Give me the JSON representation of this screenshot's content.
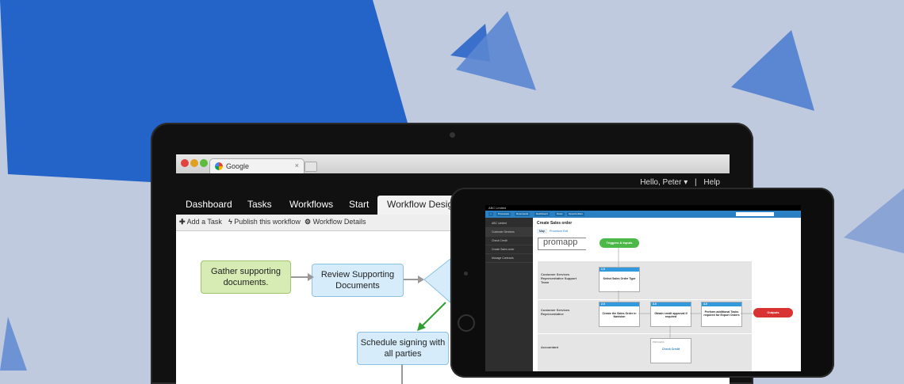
{
  "colors": {
    "background": "#c0cade",
    "triangle_primary": "#2463c8",
    "triangle_light": "#5a86d2",
    "app_header": "#111111",
    "tablet_nav": "#2b80c4",
    "node_green": "#d7ecb4",
    "node_blue": "#d6ecfa",
    "trigger_green": "#4cb848",
    "outputs_red": "#d93232"
  },
  "laptop": {
    "browser": {
      "tab_title": "Google",
      "tab_close": "×"
    },
    "app": {
      "greeting": "Hello, Peter ▾",
      "separator": "|",
      "help": "Help",
      "nav": [
        "Dashboard",
        "Tasks",
        "Workflows",
        "Start",
        "Workflow Designer"
      ],
      "toolbar": {
        "add_task": "Add a Task",
        "publish": "Publish this workflow",
        "details": "Workflow Details"
      },
      "nodes": {
        "gather": "Gather supporting documents.",
        "review": "Review Supporting Documents",
        "schedule": "Schedule signing with all parties"
      }
    }
  },
  "tablet": {
    "topbar": "ABC Limited",
    "nav": [
      "Processes",
      "Documents",
      "Dashboard",
      "News",
      "Opportunities"
    ],
    "sidebar": [
      "ABC Limited",
      "Customer Services",
      "Check Credit",
      "Create Sales order",
      "Manage Contracts"
    ],
    "page_title": "Create Sales order",
    "page_tabs": [
      "Map",
      "Procedure",
      "Edit"
    ],
    "logo": "promapp",
    "triggers": "Triggers & Inputs",
    "outputs": "Outputs",
    "lanes": {
      "lane1": "Customer Services Representative Support Team",
      "lane2": "Customer Services Representative",
      "lane3": "Accountant"
    },
    "cards": {
      "c1": {
        "num": "1.0",
        "text": "Select Sales Order Type"
      },
      "c2": {
        "num": "2.0",
        "text": "Create the Sales Order in Navision"
      },
      "c3": {
        "num": "3.0",
        "text": "Obtain credit approval if required"
      },
      "c4": {
        "num": "4.0",
        "text": "Perform additional Tasks required for Export Orders"
      }
    },
    "process_card": {
      "tag": "PROCESS",
      "text": "Check Credit"
    }
  }
}
